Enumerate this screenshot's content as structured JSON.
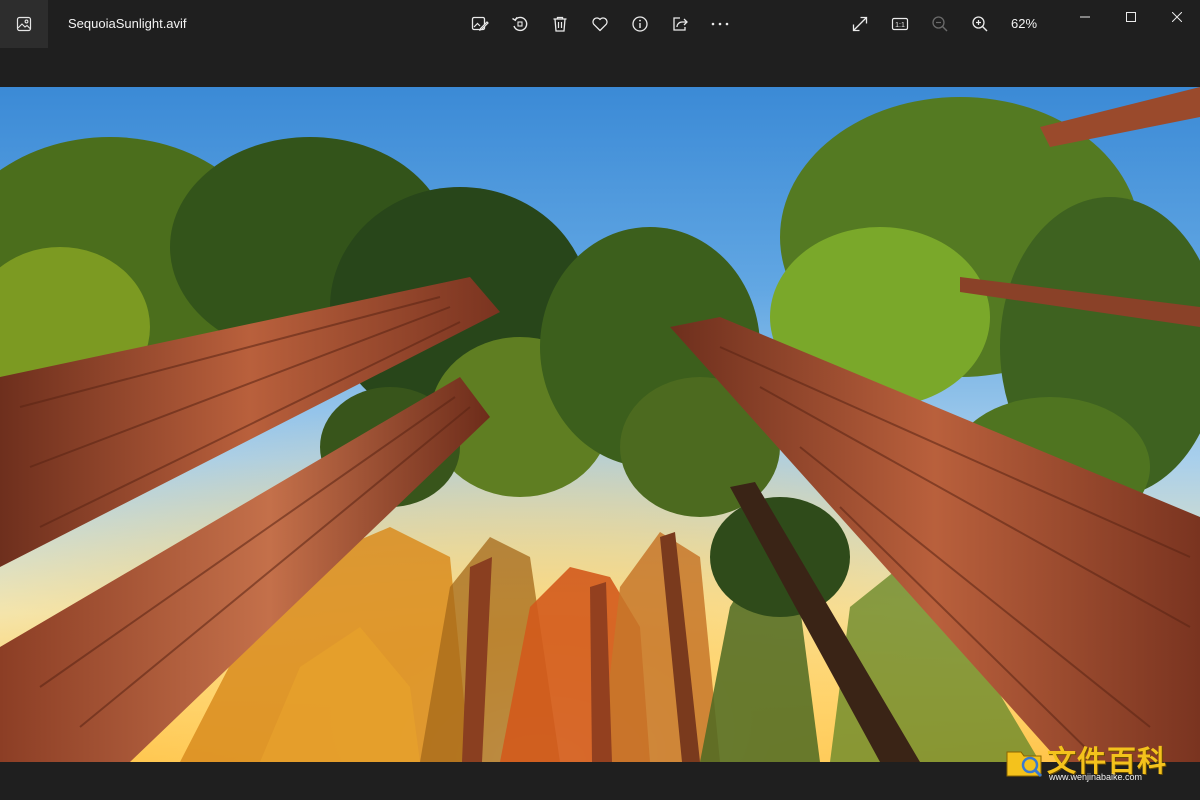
{
  "window": {
    "filename": "SequoiaSunlight.avif"
  },
  "toolbar": {
    "center_icons": [
      "edit-image-icon",
      "rotate-icon",
      "delete-icon",
      "favorite-heart-icon",
      "info-icon",
      "share-icon",
      "more-options-icon"
    ],
    "right_icons": [
      "fullscreen-icon",
      "actual-size-icon",
      "zoom-out-icon",
      "zoom-in-icon"
    ],
    "actual_size_label": "1:1",
    "zoom_value": "62%"
  },
  "watermark": {
    "brand": "文件百科",
    "url": "www.wenjinabaike.com"
  },
  "colors": {
    "chrome": "#1f1f1f",
    "sky_top": "#3b8ad6",
    "sun": "#ffbf3f",
    "bark": "#9a4a2c",
    "foliage": "#3d6a1e"
  }
}
